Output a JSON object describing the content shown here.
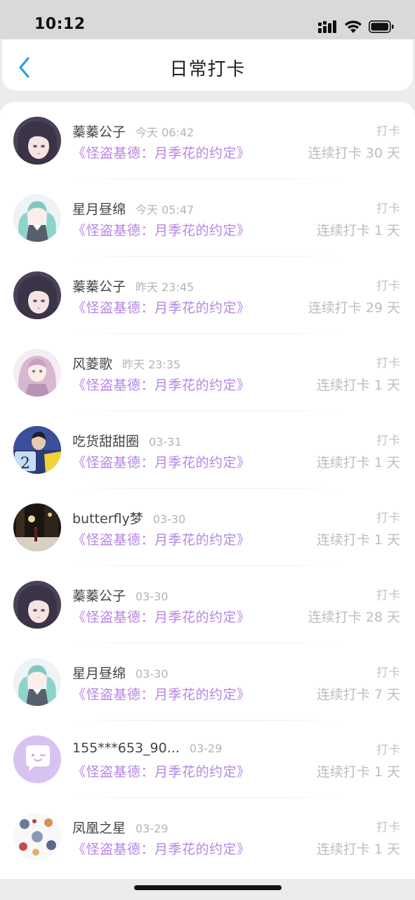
{
  "status_bar": {
    "time": "10:12"
  },
  "header": {
    "title": "日常打卡",
    "back_icon": "chevron-left-icon",
    "accent_color": "#2a9ee8"
  },
  "colors": {
    "book_title": "#b786e3",
    "muted": "#bdbdbd"
  },
  "list": [
    {
      "user": "蓁蓁公子",
      "time": "今天 06:42",
      "book": "《怪盗基德：月季花的约定》",
      "action": "打卡",
      "streak": "连续打卡 30 天",
      "avatar": "anime-girl-purple-hair"
    },
    {
      "user": "星月昼绵",
      "time": "今天 05:47",
      "book": "《怪盗基德：月季花的约定》",
      "action": "打卡",
      "streak": "连续打卡 1 天",
      "avatar": "anime-girl-teal-twintails"
    },
    {
      "user": "蓁蓁公子",
      "time": "昨天 23:45",
      "book": "《怪盗基德：月季花的约定》",
      "action": "打卡",
      "streak": "连续打卡 29 天",
      "avatar": "anime-girl-purple-hair"
    },
    {
      "user": "风菱歌",
      "time": "昨天 23:35",
      "book": "《怪盗基德：月季花的约定》",
      "action": "打卡",
      "streak": "连续打卡 1 天",
      "avatar": "anime-girl-pink-hair"
    },
    {
      "user": "吃货甜甜圈",
      "time": "03-31",
      "book": "《怪盗基德：月季花的约定》",
      "action": "打卡",
      "streak": "连续打卡 1 天",
      "avatar": "boy-number-2"
    },
    {
      "user": "butterfly梦",
      "time": "03-30",
      "book": "《怪盗基德：月季花的约定》",
      "action": "打卡",
      "streak": "连续打卡 1 天",
      "avatar": "night-street-scene"
    },
    {
      "user": "蓁蓁公子",
      "time": "03-30",
      "book": "《怪盗基德：月季花的约定》",
      "action": "打卡",
      "streak": "连续打卡 28 天",
      "avatar": "anime-girl-purple-hair"
    },
    {
      "user": "星月昼绵",
      "time": "03-30",
      "book": "《怪盗基德：月季花的约定》",
      "action": "打卡",
      "streak": "连续打卡 7 天",
      "avatar": "anime-girl-teal-twintails"
    },
    {
      "user": "155***653_90...",
      "time": "03-29",
      "book": "《怪盗基德：月季花的约定》",
      "action": "打卡",
      "streak": "连续打卡 1 天",
      "avatar": "default-chat-bubble"
    },
    {
      "user": "凤凰之星",
      "time": "03-29",
      "book": "《怪盗基德：月季花的约定》",
      "action": "打卡",
      "streak": "连续打卡 1 天",
      "avatar": "cartoon-characters-collage"
    }
  ]
}
